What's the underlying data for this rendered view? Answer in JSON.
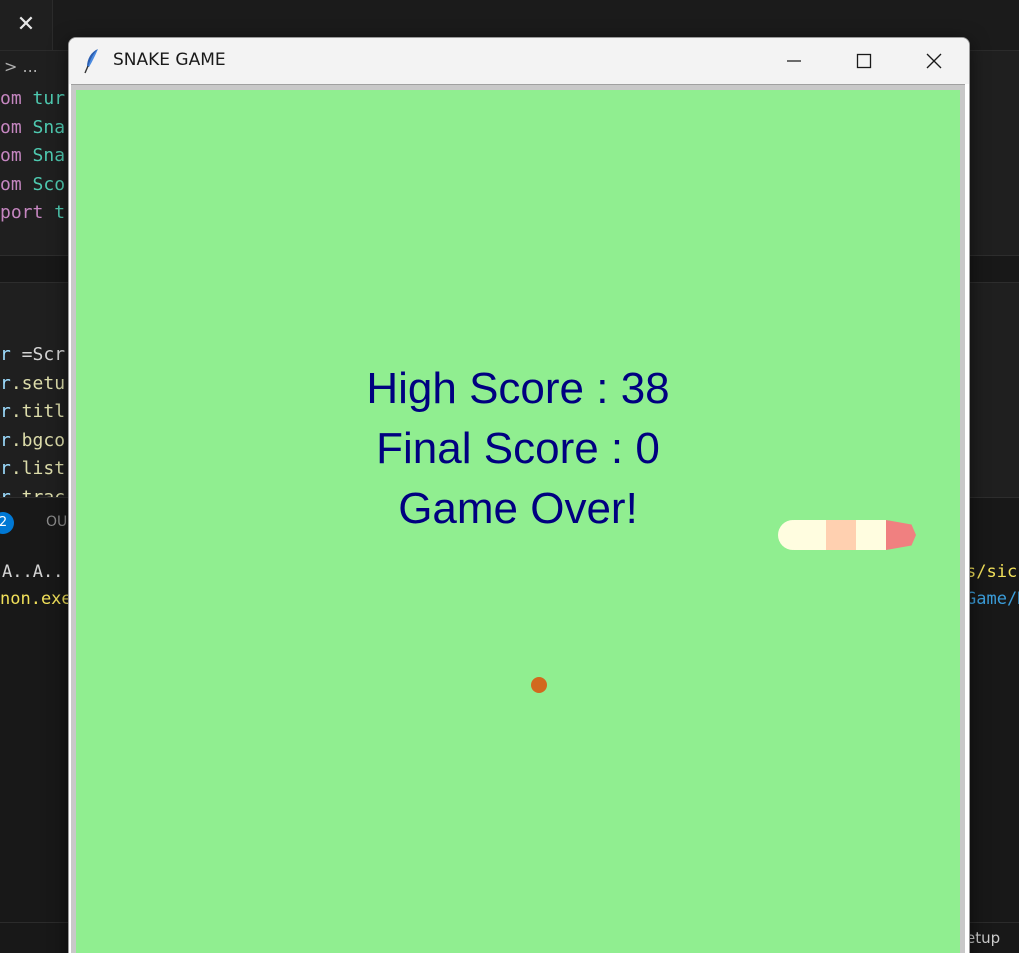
{
  "editor": {
    "tab_close_glyph": "✕",
    "breadcrumb": "> ...",
    "code_top": [
      {
        "kw": "om",
        "rest": " tur"
      },
      {
        "kw": "om",
        "rest": " Sna"
      },
      {
        "kw": "om",
        "rest": " Sna"
      },
      {
        "kw": "om",
        "rest": " Sco"
      },
      {
        "kw": "port",
        "rest": " t"
      }
    ],
    "code_mid": [
      {
        "a": "r",
        "b": " =Scr"
      },
      {
        "a": "r",
        "b": ".setu"
      },
      {
        "a": "r",
        "b": ".titl"
      },
      {
        "a": "r",
        "b": ".bgco"
      },
      {
        "a": "r",
        "b": ".list"
      },
      {
        "a": "r",
        "b": ".trac"
      }
    ],
    "panel_badge": "2",
    "panel_tab": "OU",
    "terminal_lines": [
      "A..A..",
      "non.exe"
    ],
    "terminal_right": [
      "s/sic",
      "Game/N"
    ],
    "status_text": "etup"
  },
  "window": {
    "title": "SNAKE GAME",
    "min_glyph": "—",
    "close_glyph": "✕"
  },
  "game": {
    "high_score_text": "High Score : 38",
    "final_score_text": "Final Score : 0",
    "game_over_text": "Game Over!",
    "high_score": 38,
    "final_score": 0,
    "colors": {
      "background": "#90ee90",
      "text": "#000080",
      "food": "#d2691e",
      "snake_head": "#fffde0",
      "snake_segments": [
        "#fffde0",
        "#ffd0b0",
        "#fffde0",
        "#f08080"
      ]
    }
  }
}
